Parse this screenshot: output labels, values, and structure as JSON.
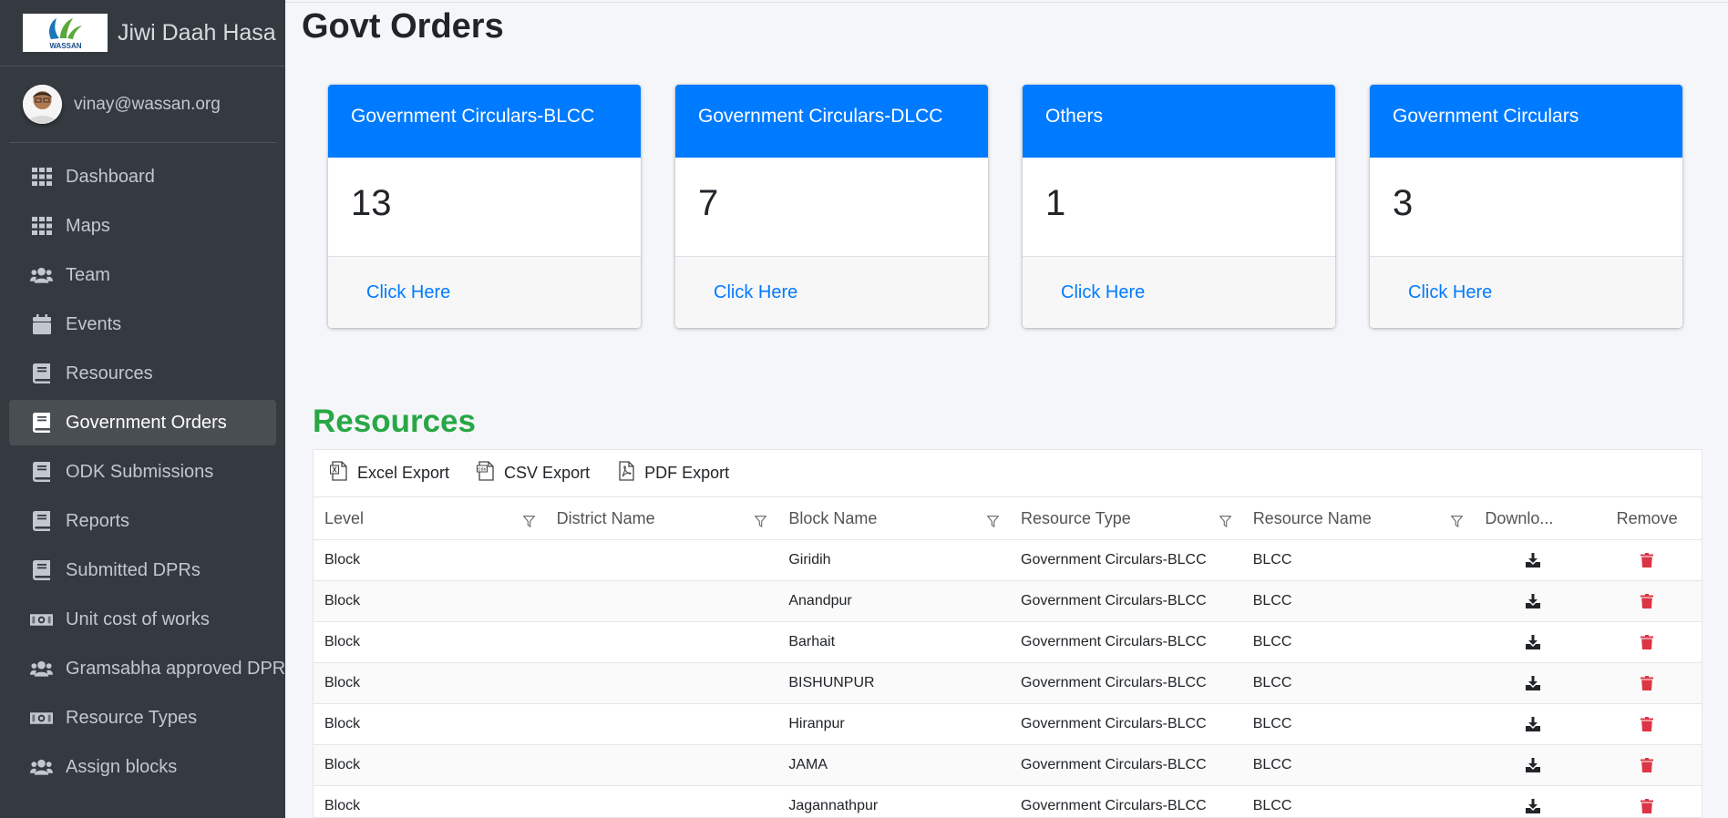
{
  "brand": {
    "name": "Jiwi Daah Hasa",
    "logo_text": "WASSAN"
  },
  "user": {
    "email": "vinay@wassan.org"
  },
  "sidebar": {
    "items": [
      {
        "label": "Dashboard",
        "icon": "grid-icon"
      },
      {
        "label": "Maps",
        "icon": "grid-icon"
      },
      {
        "label": "Team",
        "icon": "users-icon"
      },
      {
        "label": "Events",
        "icon": "calendar-icon"
      },
      {
        "label": "Resources",
        "icon": "book-icon"
      },
      {
        "label": "Government Orders",
        "icon": "book-icon",
        "active": true
      },
      {
        "label": "ODK Submissions",
        "icon": "book-icon"
      },
      {
        "label": "Reports",
        "icon": "book-icon"
      },
      {
        "label": "Submitted DPRs",
        "icon": "book-icon"
      },
      {
        "label": "Unit cost of works",
        "icon": "money-icon"
      },
      {
        "label": "Gramsabha approved DPR",
        "icon": "users-icon"
      },
      {
        "label": "Resource Types",
        "icon": "money-icon"
      },
      {
        "label": "Assign blocks",
        "icon": "users-icon"
      }
    ]
  },
  "page": {
    "title": "Govt Orders"
  },
  "cards": [
    {
      "title": "Government Circulars-BLCC",
      "count": "13",
      "link": "Click Here"
    },
    {
      "title": "Government Circulars-DLCC",
      "count": "7",
      "link": "Click Here"
    },
    {
      "title": "Others",
      "count": "1",
      "link": "Click Here"
    },
    {
      "title": "Government Circulars",
      "count": "3",
      "link": "Click Here"
    }
  ],
  "resources": {
    "title": "Resources",
    "toolbar": {
      "excel": "Excel Export",
      "csv": "CSV Export",
      "pdf": "PDF Export"
    },
    "columns": [
      "Level",
      "District Name",
      "Block Name",
      "Resource Type",
      "Resource Name",
      "Downlo...",
      "Remove"
    ],
    "rows": [
      {
        "level": "Block",
        "district": "",
        "block": "Giridih",
        "type": "Government Circulars-BLCC",
        "name": "BLCC"
      },
      {
        "level": "Block",
        "district": "",
        "block": "Anandpur",
        "type": "Government Circulars-BLCC",
        "name": "BLCC"
      },
      {
        "level": "Block",
        "district": "",
        "block": "Barhait",
        "type": "Government Circulars-BLCC",
        "name": "BLCC"
      },
      {
        "level": "Block",
        "district": "",
        "block": "BISHUNPUR",
        "type": "Government Circulars-BLCC",
        "name": "BLCC"
      },
      {
        "level": "Block",
        "district": "",
        "block": "Hiranpur",
        "type": "Government Circulars-BLCC",
        "name": "BLCC"
      },
      {
        "level": "Block",
        "district": "",
        "block": "JAMA",
        "type": "Government Circulars-BLCC",
        "name": "BLCC"
      },
      {
        "level": "Block",
        "district": "",
        "block": "Jagannathpur",
        "type": "Government Circulars-BLCC",
        "name": "BLCC"
      }
    ]
  },
  "colors": {
    "sidebar_bg": "#343a40",
    "primary": "#007bff",
    "success": "#28a745",
    "danger": "#dc3545"
  }
}
